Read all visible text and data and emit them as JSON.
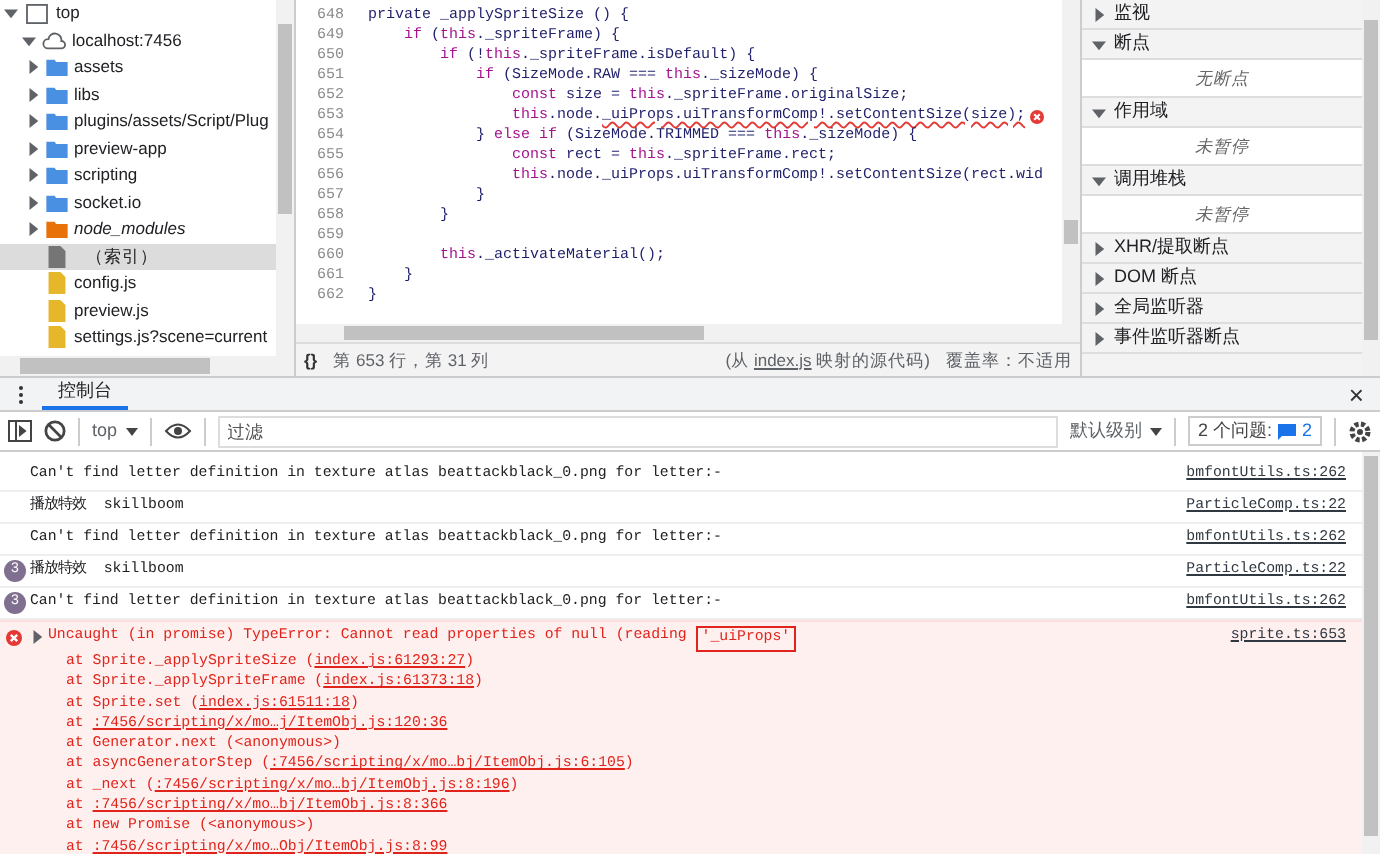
{
  "file_tree": {
    "label": "top",
    "expanded": true,
    "children": [
      {
        "label": "localhost:7456",
        "expanded": true,
        "children": [
          {
            "label": "assets",
            "kind": "folder",
            "selected": false
          },
          {
            "label": "libs",
            "kind": "folder",
            "selected": false
          },
          {
            "label": "plugins/assets/Script/Plug",
            "kind": "folder",
            "selected": false
          },
          {
            "label": "preview-app",
            "kind": "folder",
            "selected": false
          },
          {
            "label": "scripting",
            "kind": "folder",
            "selected": false
          },
          {
            "label": "socket.io",
            "kind": "folder",
            "selected": false
          },
          {
            "label": "node_modules",
            "kind": "modules",
            "selected": false
          },
          {
            "label": "（索引）",
            "kind": "page",
            "selected": true
          },
          {
            "label": "config.js",
            "kind": "script",
            "selected": false
          },
          {
            "label": "preview.js",
            "kind": "script",
            "selected": false
          },
          {
            "label": "settings.js?scene=current",
            "kind": "script",
            "selected": false
          }
        ]
      }
    ]
  },
  "editor": {
    "lines": [
      {
        "number": "648",
        "error": false,
        "tokens": [
          {
            "t": "private _applySpriteSize () {",
            "kind": "plain"
          }
        ]
      },
      {
        "number": "649",
        "error": false,
        "tokens": [
          {
            "t": "    if",
            "kind": "kw"
          },
          {
            "t": " (",
            "kind": "plain"
          },
          {
            "t": "this",
            "kind": "kw"
          },
          {
            "t": "._spriteFrame) {",
            "kind": "plain"
          }
        ]
      },
      {
        "number": "650",
        "error": false,
        "tokens": [
          {
            "t": "        if",
            "kind": "kw"
          },
          {
            "t": " (!",
            "kind": "plain"
          },
          {
            "t": "this",
            "kind": "kw"
          },
          {
            "t": "._spriteFrame.isDefault) {",
            "kind": "plain"
          }
        ]
      },
      {
        "number": "651",
        "error": false,
        "tokens": [
          {
            "t": "            if",
            "kind": "kw"
          },
          {
            "t": " (SizeMode.RAW === ",
            "kind": "plain"
          },
          {
            "t": "this",
            "kind": "kw"
          },
          {
            "t": "._sizeMode) {",
            "kind": "plain"
          }
        ]
      },
      {
        "number": "652",
        "error": false,
        "tokens": [
          {
            "t": "                const",
            "kind": "kw"
          },
          {
            "t": " size = ",
            "kind": "plain"
          },
          {
            "t": "this",
            "kind": "kw"
          },
          {
            "t": "._spriteFrame.originalSize;",
            "kind": "plain"
          }
        ]
      },
      {
        "number": "653",
        "error": true,
        "tokens": [
          {
            "t": "                this",
            "kind": "kw"
          },
          {
            "t": ".node.",
            "kind": "plain"
          },
          {
            "t": "_uiProps.uiTransformComp!.setContentSize(size);",
            "kind": "bad"
          }
        ]
      },
      {
        "number": "654",
        "error": false,
        "tokens": [
          {
            "t": "            } ",
            "kind": "plain"
          },
          {
            "t": "else if",
            "kind": "kw"
          },
          {
            "t": " (SizeMode.TRIMMED === ",
            "kind": "plain"
          },
          {
            "t": "this",
            "kind": "kw"
          },
          {
            "t": "._sizeMode) {",
            "kind": "plain"
          }
        ]
      },
      {
        "number": "655",
        "error": false,
        "tokens": [
          {
            "t": "                const",
            "kind": "kw"
          },
          {
            "t": " rect = ",
            "kind": "plain"
          },
          {
            "t": "this",
            "kind": "kw"
          },
          {
            "t": "._spriteFrame.rect;",
            "kind": "plain"
          }
        ]
      },
      {
        "number": "656",
        "error": false,
        "tokens": [
          {
            "t": "                this",
            "kind": "kw"
          },
          {
            "t": ".node._uiProps.uiTransformComp!.setContentSize(rect.wid",
            "kind": "plain"
          }
        ]
      },
      {
        "number": "657",
        "error": false,
        "tokens": [
          {
            "t": "            }",
            "kind": "plain"
          }
        ]
      },
      {
        "number": "658",
        "error": false,
        "tokens": [
          {
            "t": "        }",
            "kind": "plain"
          }
        ]
      },
      {
        "number": "659",
        "error": false
      },
      {
        "number": "660",
        "error": false,
        "tokens": [
          {
            "t": "        this",
            "kind": "kw"
          },
          {
            "t": "._activateMaterial();",
            "kind": "plain"
          }
        ]
      },
      {
        "number": "661",
        "error": false,
        "tokens": [
          {
            "t": "    }",
            "kind": "plain"
          }
        ]
      },
      {
        "number": "662",
        "error": false,
        "tokens": [
          {
            "t": "}",
            "kind": "plain"
          }
        ]
      }
    ],
    "status": {
      "braces": "{}",
      "position": "第 653 行，第 31 列",
      "source_before": "(从",
      "source_link": "index.js",
      "source_after": "映射的源代码)",
      "coverage": "覆盖率：不适用"
    }
  },
  "debugger_panel": [
    {
      "title": "监视",
      "expanded": false
    },
    {
      "title": "断点",
      "expanded": true,
      "content": "无断点"
    },
    {
      "title": "作用域",
      "expanded": true,
      "content": "未暂停"
    },
    {
      "title": "调用堆栈",
      "expanded": true,
      "content": "未暂停"
    },
    {
      "title": "XHR/提取断点",
      "expanded": false
    },
    {
      "title": "DOM 断点",
      "expanded": false
    },
    {
      "title": "全局监听器",
      "expanded": false
    },
    {
      "title": "事件监听器断点",
      "expanded": false
    }
  ],
  "drawer": {
    "tabs": [
      {
        "label": "控制台",
        "selected": true
      }
    ],
    "close": "×"
  },
  "toolbar": {
    "context": "top",
    "filter_placeholder": "过滤",
    "level": "默认级别",
    "issues": "2 个问题:",
    "issues_count": "2"
  },
  "messages": [
    {
      "kind": "log",
      "text": "Can't find letter definition in texture atlas beattackblack_0.png for letter:-",
      "source": "bmfontUtils.ts:262"
    },
    {
      "kind": "log",
      "text": "播放特效  skillboom",
      "source": "ParticleComp.ts:22"
    },
    {
      "kind": "log",
      "text": "Can't find letter definition in texture atlas beattackblack_0.png for letter:-",
      "source": "bmfontUtils.ts:262"
    },
    {
      "kind": "log",
      "count": "3",
      "text": "播放特效  skillboom",
      "source": "ParticleComp.ts:22"
    },
    {
      "kind": "log",
      "count": "3",
      "text": "Can't find letter definition in texture atlas beattackblack_0.png for letter:-",
      "source": "bmfontUtils.ts:262"
    },
    {
      "kind": "error",
      "text": "Uncaught (in promise) TypeError: Cannot read properties of null (reading",
      "highlight": "'_uiProps'",
      "source": "sprite.ts:653",
      "stack": [
        {
          "before": "at Sprite._applySpriteSize (",
          "link": "index.js:61293:27",
          "after": ")"
        },
        {
          "before": "at Sprite._applySpriteFrame (",
          "link": "index.js:61373:18",
          "after": ")"
        },
        {
          "before": "at Sprite.set (",
          "link": "index.js:61511:18",
          "after": ")"
        },
        {
          "before": "at ",
          "link": ":7456/scripting/x/mo…j/ItemObj.js:120:36"
        },
        {
          "before": "at Generator.next (<anonymous>)"
        },
        {
          "before": "at asyncGeneratorStep (",
          "link": ":7456/scripting/x/mo…bj/ItemObj.js:6:105",
          "after": ")"
        },
        {
          "before": "at _next (",
          "link": ":7456/scripting/x/mo…bj/ItemObj.js:8:196",
          "after": ")"
        },
        {
          "before": "at ",
          "link": ":7456/scripting/x/mo…bj/ItemObj.js:8:366"
        },
        {
          "before": "at new Promise (<anonymous>)"
        },
        {
          "before": "at ",
          "link": ":7456/scripting/x/mo…Obj/ItemObj.js:8:99"
        }
      ]
    }
  ]
}
